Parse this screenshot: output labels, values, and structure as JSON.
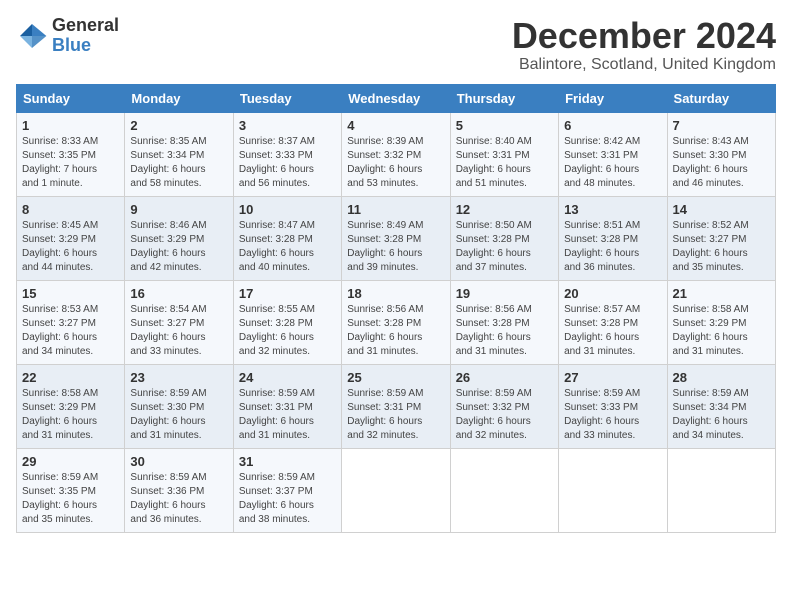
{
  "header": {
    "logo_general": "General",
    "logo_blue": "Blue",
    "month_title": "December 2024",
    "location": "Balintore, Scotland, United Kingdom"
  },
  "columns": [
    "Sunday",
    "Monday",
    "Tuesday",
    "Wednesday",
    "Thursday",
    "Friday",
    "Saturday"
  ],
  "weeks": [
    [
      {
        "day": "1",
        "detail": "Sunrise: 8:33 AM\nSunset: 3:35 PM\nDaylight: 7 hours\nand 1 minute."
      },
      {
        "day": "2",
        "detail": "Sunrise: 8:35 AM\nSunset: 3:34 PM\nDaylight: 6 hours\nand 58 minutes."
      },
      {
        "day": "3",
        "detail": "Sunrise: 8:37 AM\nSunset: 3:33 PM\nDaylight: 6 hours\nand 56 minutes."
      },
      {
        "day": "4",
        "detail": "Sunrise: 8:39 AM\nSunset: 3:32 PM\nDaylight: 6 hours\nand 53 minutes."
      },
      {
        "day": "5",
        "detail": "Sunrise: 8:40 AM\nSunset: 3:31 PM\nDaylight: 6 hours\nand 51 minutes."
      },
      {
        "day": "6",
        "detail": "Sunrise: 8:42 AM\nSunset: 3:31 PM\nDaylight: 6 hours\nand 48 minutes."
      },
      {
        "day": "7",
        "detail": "Sunrise: 8:43 AM\nSunset: 3:30 PM\nDaylight: 6 hours\nand 46 minutes."
      }
    ],
    [
      {
        "day": "8",
        "detail": "Sunrise: 8:45 AM\nSunset: 3:29 PM\nDaylight: 6 hours\nand 44 minutes."
      },
      {
        "day": "9",
        "detail": "Sunrise: 8:46 AM\nSunset: 3:29 PM\nDaylight: 6 hours\nand 42 minutes."
      },
      {
        "day": "10",
        "detail": "Sunrise: 8:47 AM\nSunset: 3:28 PM\nDaylight: 6 hours\nand 40 minutes."
      },
      {
        "day": "11",
        "detail": "Sunrise: 8:49 AM\nSunset: 3:28 PM\nDaylight: 6 hours\nand 39 minutes."
      },
      {
        "day": "12",
        "detail": "Sunrise: 8:50 AM\nSunset: 3:28 PM\nDaylight: 6 hours\nand 37 minutes."
      },
      {
        "day": "13",
        "detail": "Sunrise: 8:51 AM\nSunset: 3:28 PM\nDaylight: 6 hours\nand 36 minutes."
      },
      {
        "day": "14",
        "detail": "Sunrise: 8:52 AM\nSunset: 3:27 PM\nDaylight: 6 hours\nand 35 minutes."
      }
    ],
    [
      {
        "day": "15",
        "detail": "Sunrise: 8:53 AM\nSunset: 3:27 PM\nDaylight: 6 hours\nand 34 minutes."
      },
      {
        "day": "16",
        "detail": "Sunrise: 8:54 AM\nSunset: 3:27 PM\nDaylight: 6 hours\nand 33 minutes."
      },
      {
        "day": "17",
        "detail": "Sunrise: 8:55 AM\nSunset: 3:28 PM\nDaylight: 6 hours\nand 32 minutes."
      },
      {
        "day": "18",
        "detail": "Sunrise: 8:56 AM\nSunset: 3:28 PM\nDaylight: 6 hours\nand 31 minutes."
      },
      {
        "day": "19",
        "detail": "Sunrise: 8:56 AM\nSunset: 3:28 PM\nDaylight: 6 hours\nand 31 minutes."
      },
      {
        "day": "20",
        "detail": "Sunrise: 8:57 AM\nSunset: 3:28 PM\nDaylight: 6 hours\nand 31 minutes."
      },
      {
        "day": "21",
        "detail": "Sunrise: 8:58 AM\nSunset: 3:29 PM\nDaylight: 6 hours\nand 31 minutes."
      }
    ],
    [
      {
        "day": "22",
        "detail": "Sunrise: 8:58 AM\nSunset: 3:29 PM\nDaylight: 6 hours\nand 31 minutes."
      },
      {
        "day": "23",
        "detail": "Sunrise: 8:59 AM\nSunset: 3:30 PM\nDaylight: 6 hours\nand 31 minutes."
      },
      {
        "day": "24",
        "detail": "Sunrise: 8:59 AM\nSunset: 3:31 PM\nDaylight: 6 hours\nand 31 minutes."
      },
      {
        "day": "25",
        "detail": "Sunrise: 8:59 AM\nSunset: 3:31 PM\nDaylight: 6 hours\nand 32 minutes."
      },
      {
        "day": "26",
        "detail": "Sunrise: 8:59 AM\nSunset: 3:32 PM\nDaylight: 6 hours\nand 32 minutes."
      },
      {
        "day": "27",
        "detail": "Sunrise: 8:59 AM\nSunset: 3:33 PM\nDaylight: 6 hours\nand 33 minutes."
      },
      {
        "day": "28",
        "detail": "Sunrise: 8:59 AM\nSunset: 3:34 PM\nDaylight: 6 hours\nand 34 minutes."
      }
    ],
    [
      {
        "day": "29",
        "detail": "Sunrise: 8:59 AM\nSunset: 3:35 PM\nDaylight: 6 hours\nand 35 minutes."
      },
      {
        "day": "30",
        "detail": "Sunrise: 8:59 AM\nSunset: 3:36 PM\nDaylight: 6 hours\nand 36 minutes."
      },
      {
        "day": "31",
        "detail": "Sunrise: 8:59 AM\nSunset: 3:37 PM\nDaylight: 6 hours\nand 38 minutes."
      },
      {
        "day": "",
        "detail": ""
      },
      {
        "day": "",
        "detail": ""
      },
      {
        "day": "",
        "detail": ""
      },
      {
        "day": "",
        "detail": ""
      }
    ]
  ]
}
